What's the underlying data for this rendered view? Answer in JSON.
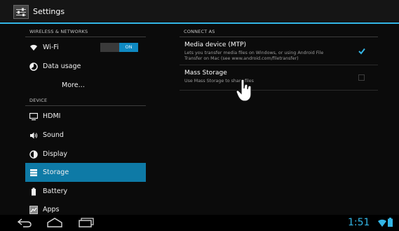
{
  "app_bar": {
    "title": "Settings",
    "icon": "settings-sliders-icon"
  },
  "left_pane": {
    "section_wireless": "WIRELESS & NETWORKS",
    "wifi": {
      "label": "Wi-Fi",
      "toggle_on": "ON"
    },
    "data_usage": "Data usage",
    "more": "More…",
    "section_device": "DEVICE",
    "hdmi": "HDMI",
    "sound": "Sound",
    "display": "Display",
    "storage": "Storage",
    "battery": "Battery",
    "apps": "Apps",
    "selected_item": "Storage",
    "accent_color": "#0e7aa6"
  },
  "right_pane": {
    "section_title": "CONNECT AS",
    "mtp": {
      "title": "Media device (MTP)",
      "summary_line1": "Lets you transfer media files on Windows, or using Android File",
      "summary_line2": "Transfer on Mac (see www.android.com/filetransfer)",
      "checked": true
    },
    "mass_storage": {
      "title": "Mass Storage",
      "summary": "Use Mass Storage to share files",
      "checked": false
    }
  },
  "nav_bar": {
    "back": "back-icon",
    "home": "home-icon",
    "recents": "recents-icon",
    "clock": "1:51",
    "clock_color": "#33b5e5"
  }
}
